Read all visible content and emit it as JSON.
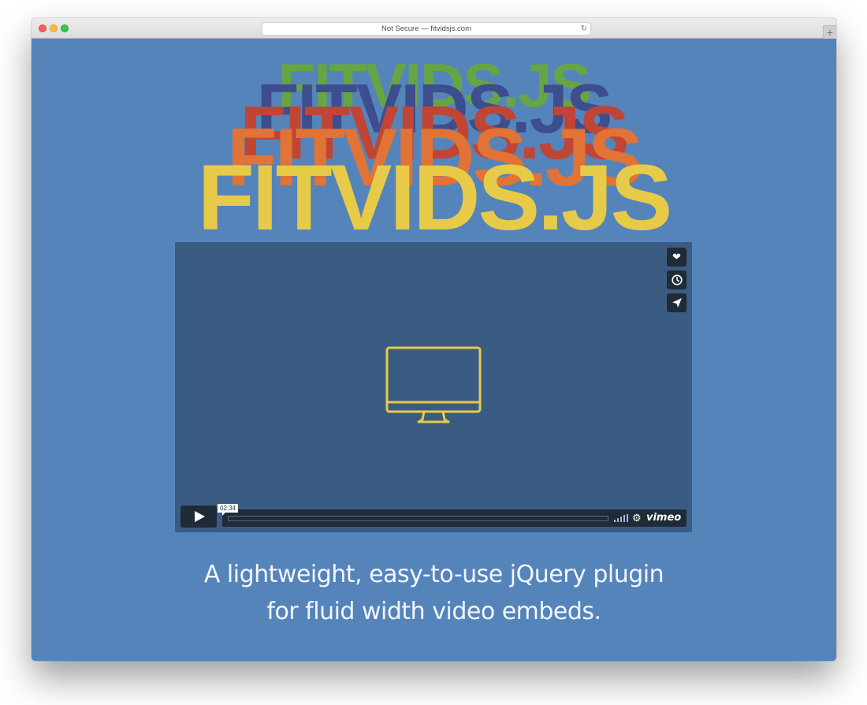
{
  "browser": {
    "url_text": "Not Secure — fitvidsjs.com",
    "reload_icon": "reload-icon",
    "new_tab_icon": "plus-icon",
    "new_tab_symbol": "+"
  },
  "colors": {
    "background": "#5584bb",
    "logo_layers": [
      "#67a544",
      "#3d4e8f",
      "#c04535",
      "#e07335",
      "#e7cb48"
    ],
    "player_background": "#3b5c82",
    "player_controls": "#1f2b38",
    "monitor_icon": "#e7cb48"
  },
  "hero": {
    "logo_text": "FITVIDS.JS"
  },
  "player": {
    "side_buttons": [
      {
        "icon": "heart-icon",
        "symbol": "❤"
      },
      {
        "icon": "clock-icon",
        "symbol": "◷"
      },
      {
        "icon": "send-icon",
        "symbol": "➤"
      }
    ],
    "time": "02:34",
    "brand": "vimeo",
    "settings_symbol": "⚙"
  },
  "tagline": {
    "line1": "A lightweight, easy-to-use jQuery plugin",
    "line2": "for fluid width video embeds."
  }
}
